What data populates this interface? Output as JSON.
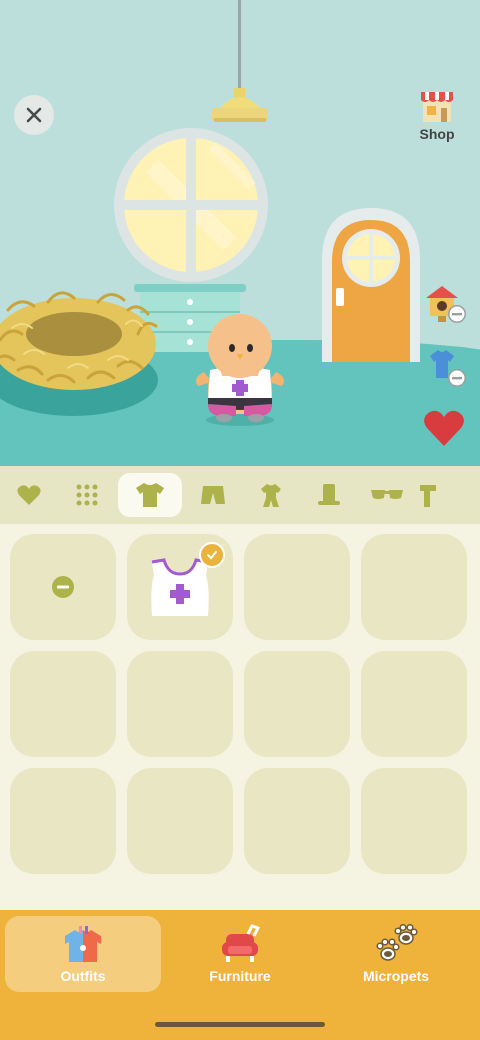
{
  "header": {
    "close_icon": "close-icon",
    "shop_label": "Shop"
  },
  "side_actions": [
    {
      "icon": "birdhouse-remove-icon"
    },
    {
      "icon": "shirt-remove-icon"
    },
    {
      "icon": "heart-icon"
    }
  ],
  "categories": [
    {
      "icon": "heart-icon",
      "active": false
    },
    {
      "icon": "grid-dots-icon",
      "active": false
    },
    {
      "icon": "tshirt-icon",
      "active": true
    },
    {
      "icon": "shorts-icon",
      "active": false
    },
    {
      "icon": "onesie-icon",
      "active": false
    },
    {
      "icon": "top-hat-icon",
      "active": false
    },
    {
      "icon": "sunglasses-icon",
      "active": false
    },
    {
      "icon": "scarf-icon",
      "active": false
    }
  ],
  "grid": {
    "slots": [
      {
        "type": "remove"
      },
      {
        "type": "item",
        "name": "tank-top-purple-cross",
        "selected": true
      },
      {
        "type": "empty"
      },
      {
        "type": "empty"
      },
      {
        "type": "empty"
      },
      {
        "type": "empty"
      },
      {
        "type": "empty"
      },
      {
        "type": "empty"
      },
      {
        "type": "empty"
      },
      {
        "type": "empty"
      },
      {
        "type": "empty"
      },
      {
        "type": "empty"
      }
    ]
  },
  "bottom_nav": {
    "tabs": [
      {
        "label": "Outfits",
        "active": true
      },
      {
        "label": "Furniture",
        "active": false
      },
      {
        "label": "Micropets",
        "active": false
      }
    ]
  },
  "colors": {
    "accent_orange": "#efb23b",
    "olive": "#aeb24a",
    "room_wall": "#bddfdc",
    "floor": "#63c3bd"
  }
}
